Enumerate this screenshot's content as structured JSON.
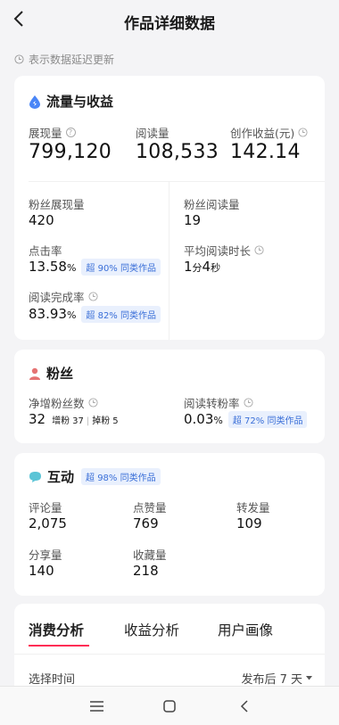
{
  "header": {
    "title": "作品详细数据"
  },
  "hint": "表示数据延迟更新",
  "traffic": {
    "title": "流量与收益",
    "exposure_label": "展现量",
    "exposure_value": "799,120",
    "reads_label": "阅读量",
    "reads_value": "108,533",
    "income_label": "创作收益(元)",
    "income_value": "142.14",
    "fan_exposure_label": "粉丝展现量",
    "fan_exposure_value": "420",
    "fan_reads_label": "粉丝阅读量",
    "fan_reads_value": "19",
    "ctr_label": "点击率",
    "ctr_value": "13.58",
    "ctr_unit": "%",
    "ctr_badge": "超 90% 同类作品",
    "avg_time_label": "平均阅读时长",
    "avg_time_min": "1",
    "avg_time_min_unit": "分",
    "avg_time_sec": "4",
    "avg_time_sec_unit": "秒",
    "completion_label": "阅读完成率",
    "completion_value": "83.93",
    "completion_unit": "%",
    "completion_badge": "超 82% 同类作品"
  },
  "fans": {
    "title": "粉丝",
    "net_label": "净增粉丝数",
    "net_value": "32",
    "gain_label": "增粉",
    "gain_value": "37",
    "lost_label": "掉粉",
    "lost_value": "5",
    "conv_label": "阅读转粉率",
    "conv_value": "0.03",
    "conv_unit": "%",
    "conv_badge": "超 72% 同类作品"
  },
  "interaction": {
    "title": "互动",
    "badge": "超 98% 同类作品",
    "comments_label": "评论量",
    "comments_value": "2,075",
    "likes_label": "点赞量",
    "likes_value": "769",
    "reposts_label": "转发量",
    "reposts_value": "109",
    "shares_label": "分享量",
    "shares_value": "140",
    "favorites_label": "收藏量",
    "favorites_value": "218"
  },
  "tabs": {
    "consumption": "消费分析",
    "income": "收益分析",
    "user": "用户画像"
  },
  "time_filter": {
    "label": "选择时间",
    "value": "发布后 7 天"
  },
  "colors": {
    "accent": "#ff2d55",
    "badge_text": "#3a6fd8",
    "badge_bg": "#e9f0fd",
    "traffic_icon": "#4a86f7",
    "fans_icon": "#e57373",
    "interaction_icon": "#5bc4d6"
  }
}
